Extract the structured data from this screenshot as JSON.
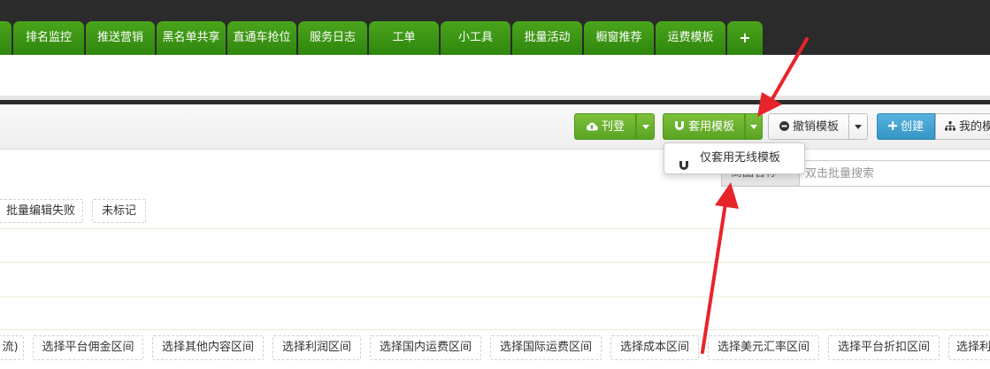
{
  "nav": {
    "tabs": [
      "排名监控",
      "推送营销",
      "黑名单共享",
      "直通车抢位",
      "服务日志",
      "工单",
      "小工具",
      "批量活动",
      "橱窗推荐",
      "运费模板",
      "+"
    ]
  },
  "toolbar": {
    "publish_label": "刊登",
    "apply_template_label": "套用模板",
    "revoke_template_label": "撤销模板",
    "create_label": "创建",
    "my_label": "我的模"
  },
  "dropdown": {
    "item_label": "仅套用无线模板"
  },
  "search": {
    "field_label": "商品名称",
    "placeholder": "双击批量搜索"
  },
  "status_filters": [
    "批量编辑失败",
    "未标记"
  ],
  "range_filters": [
    "流)",
    "选择平台佣金区间",
    "选择其他内容区间",
    "选择利润区间",
    "选择国内运费区间",
    "选择国际运费区间",
    "选择成本区间",
    "选择美元汇率区间",
    "选择平台折扣区间",
    "选择利"
  ],
  "colors": {
    "nav_green": "#3a9615",
    "button_green": "#6bb22e",
    "button_blue": "#4aa5d4",
    "annotation_red": "#e8242b"
  }
}
